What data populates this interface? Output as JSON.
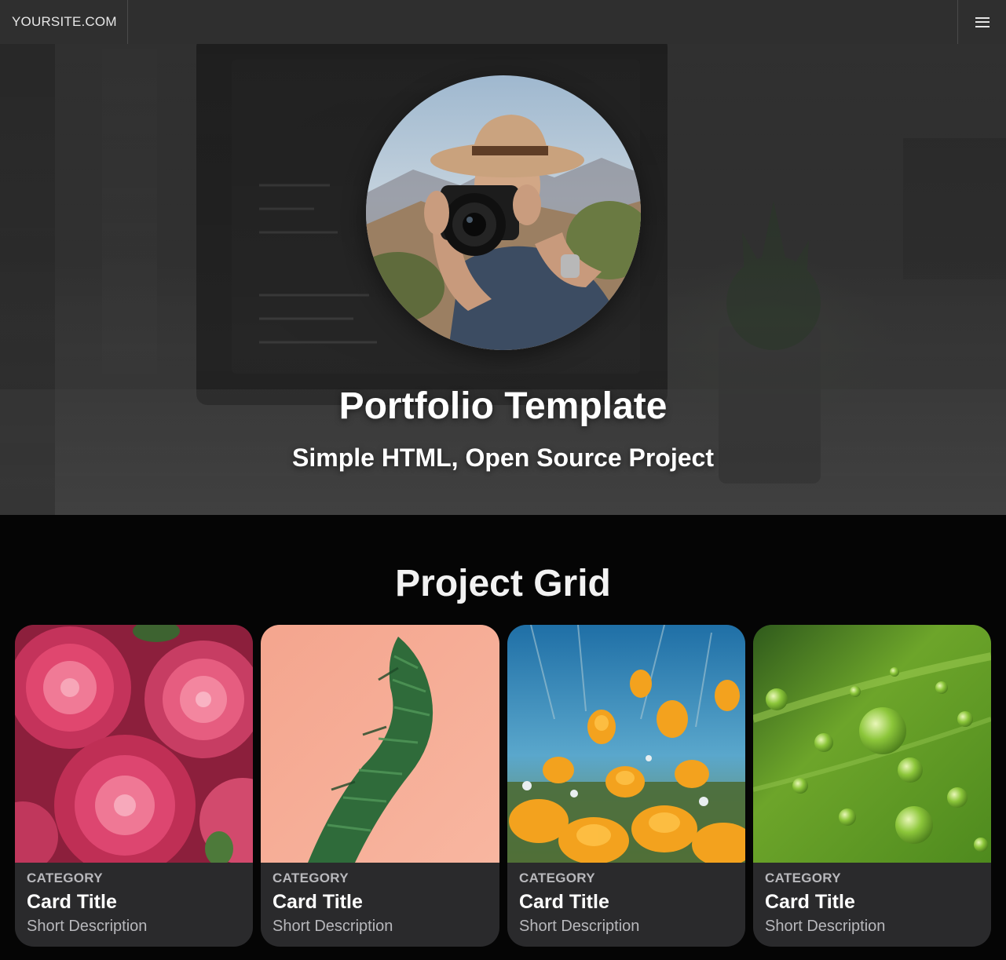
{
  "navbar": {
    "brand": "YOURSITE.COM",
    "menu_icon": "hamburger-menu-icon"
  },
  "hero": {
    "title": "Portfolio Template",
    "subtitle": "Simple HTML, Open Source Project",
    "avatar_alt": "photographer with camera"
  },
  "projects": {
    "title": "Project Grid",
    "cards": [
      {
        "category": "CATEGORY",
        "title": "Card Title",
        "description": "Short Description",
        "image": "pink-dahlias"
      },
      {
        "category": "CATEGORY",
        "title": "Card Title",
        "description": "Short Description",
        "image": "green-plant-on-peach"
      },
      {
        "category": "CATEGORY",
        "title": "Card Title",
        "description": "Short Description",
        "image": "orange-poppies"
      },
      {
        "category": "CATEGORY",
        "title": "Card Title",
        "description": "Short Description",
        "image": "water-drops-on-leaf"
      }
    ]
  },
  "colors": {
    "navbar_bg": "#2f2f2f",
    "page_bg": "#050505",
    "card_bg": "#2a2a2c",
    "muted_text": "#b8b8bc"
  }
}
